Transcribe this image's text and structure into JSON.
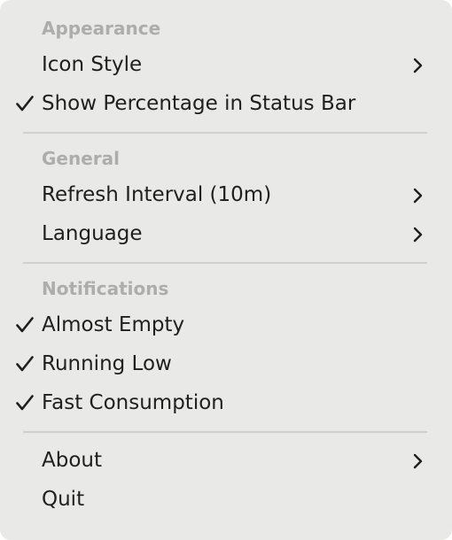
{
  "menu": {
    "appearance": {
      "header": "Appearance",
      "icon_style": "Icon Style",
      "show_percentage": "Show Percentage in Status Bar"
    },
    "general": {
      "header": "General",
      "refresh_interval": "Refresh Interval (10m)",
      "language": "Language"
    },
    "notifications": {
      "header": "Notifications",
      "almost_empty": "Almost Empty",
      "running_low": "Running Low",
      "fast_consumption": "Fast Consumption"
    },
    "footer": {
      "about": "About",
      "quit": "Quit"
    },
    "checked": {
      "show_percentage": true,
      "almost_empty": true,
      "running_low": true,
      "fast_consumption": true
    },
    "icons": {
      "check": "checkmark-icon",
      "submenu": "chevron-right-icon"
    }
  }
}
